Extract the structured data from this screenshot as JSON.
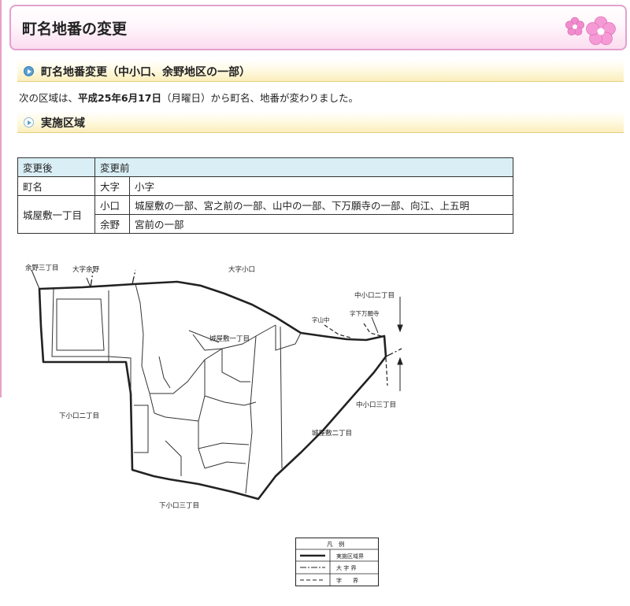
{
  "page": {
    "title": "町名地番の変更"
  },
  "section1": {
    "heading": "町名地番変更（中小口、余野地区の一部）"
  },
  "intro": {
    "before": "次の区域は、",
    "date": "平成25年6月17日",
    "weekday": "（月曜日）",
    "after": "から町名、地番が変わりました。"
  },
  "section2": {
    "heading": "実施区域"
  },
  "table": {
    "header_after": "変更後",
    "header_before": "変更前",
    "sub_col1": "町名",
    "sub_col2": "大字",
    "sub_col3": "小字",
    "new_town": "城屋敷一丁目",
    "rows": [
      {
        "oaza": "小口",
        "koaza": "城屋敷の一部、宮之前の一部、山中の一部、下万願寺の一部、向江、上五明"
      },
      {
        "oaza": "余野",
        "koaza": "宮前の一部"
      }
    ]
  },
  "map": {
    "labels": {
      "yono3": "余野三丁目",
      "oaza_yono": "大字余野",
      "oaza_oguchi": "大字小口",
      "nakaoguchi2": "中小口二丁目",
      "aza_yamanaka": "字山中",
      "aza_shimomanganji": "字下万願寺",
      "shiroyashiki1": "城屋敷一丁目",
      "shimooguchi2": "下小口二丁目",
      "nakaoguchi3": "中小口三丁目",
      "shiroyashiki2": "城屋敷二丁目",
      "shimooguchi3": "下小口三丁目"
    }
  },
  "legend": {
    "title": "凡　例",
    "items": [
      {
        "label": "実施区域界"
      },
      {
        "label": "大 字 界"
      },
      {
        "label": "字　　界"
      }
    ]
  },
  "colors": {
    "frame_pink": "#e3a0cf",
    "band_yellow": "#fbeebc",
    "table_header": "#d9eef5",
    "bullet_blue": "#5a9fd0"
  }
}
